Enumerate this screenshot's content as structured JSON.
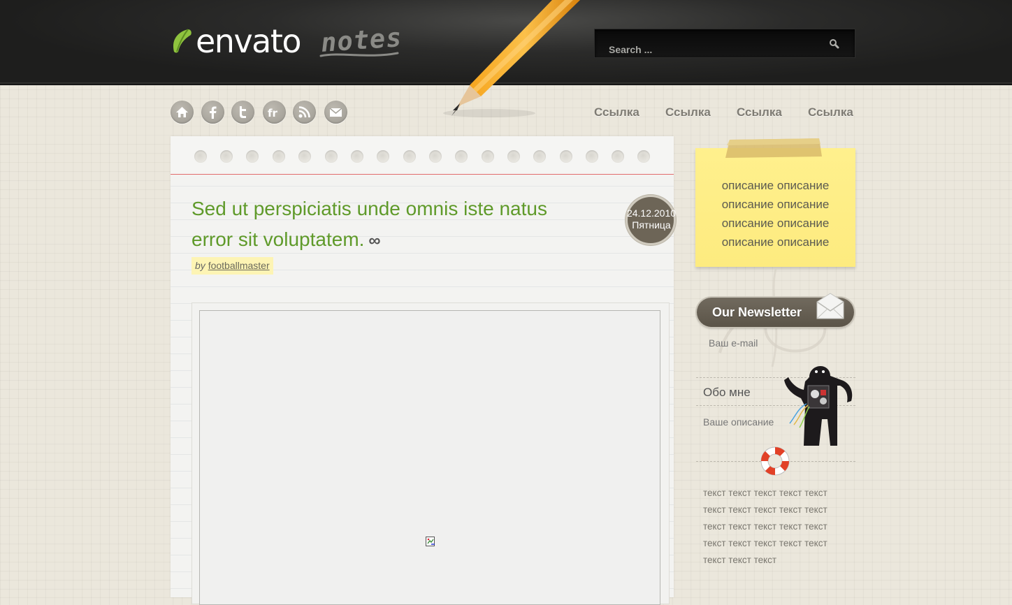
{
  "header": {
    "logo_main": "envato",
    "logo_sub": "notes",
    "search_placeholder": "Search ..."
  },
  "social": [
    {
      "name": "home-icon"
    },
    {
      "name": "facebook-icon"
    },
    {
      "name": "twitter-icon"
    },
    {
      "name": "friendfeed-icon"
    },
    {
      "name": "rss-icon"
    },
    {
      "name": "mail-icon"
    }
  ],
  "nav": {
    "links": [
      "Ссылка",
      "Ссылка",
      "Ссылка",
      "Ссылка"
    ]
  },
  "post": {
    "title_line1": "Sed ut perspiciatis unde omnis iste natus",
    "title_line2": "error sit voluptatem.",
    "permalink": "∞",
    "by": "by",
    "author": "footballmaster",
    "date": "24.12.2010",
    "weekday": "Пятница"
  },
  "sidebar": {
    "sticky_lines": [
      "описание описание",
      "описание описание",
      "описание описание",
      "описание описание"
    ],
    "newsletter_title": "Our Newsletter",
    "email_placeholder": "Ваш e-mail",
    "about_title": "Обо мне",
    "about_desc": "Ваше описание",
    "text_lines": [
      "текст текст текст текст текст",
      "текст текст текст текст текст",
      "текст текст текст текст текст",
      "текст текст текст текст текст",
      "текст текст текст"
    ]
  },
  "colors": {
    "title_green": "#5f9a2a",
    "sticky_yellow": "#fff08d",
    "header_dark": "#1e1e1d",
    "notebook_red_line": "#e26b6b"
  }
}
